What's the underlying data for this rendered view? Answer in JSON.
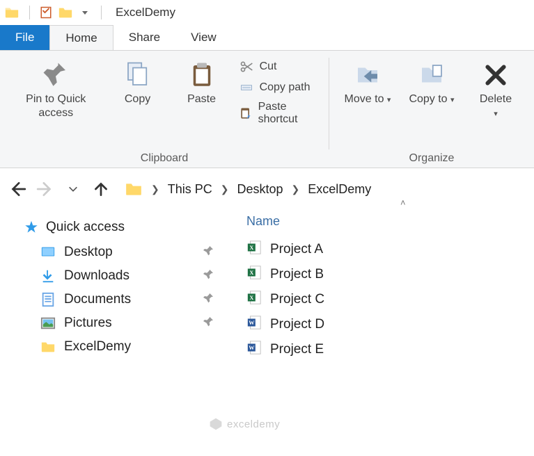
{
  "title": "ExcelDemy",
  "tabs": {
    "file": "File",
    "home": "Home",
    "share": "Share",
    "view": "View"
  },
  "ribbon": {
    "pin": "Pin to Quick access",
    "copy": "Copy",
    "paste": "Paste",
    "cut": "Cut",
    "copypath": "Copy path",
    "pasteshort": "Paste shortcut",
    "clipboard": "Clipboard",
    "moveto": "Move to",
    "copyto": "Copy to",
    "delete": "Delete",
    "organize": "Organize"
  },
  "breadcrumb": {
    "a": "This PC",
    "b": "Desktop",
    "c": "ExcelDemy"
  },
  "sidebar": {
    "head": "Quick access",
    "items": [
      "Desktop",
      "Downloads",
      "Documents",
      "Pictures",
      "ExcelDemy"
    ]
  },
  "columns": {
    "name": "Name"
  },
  "files": [
    {
      "name": "Project A",
      "type": "excel"
    },
    {
      "name": "Project B",
      "type": "excel"
    },
    {
      "name": "Project C",
      "type": "excel"
    },
    {
      "name": "Project D",
      "type": "word"
    },
    {
      "name": "Project E",
      "type": "word"
    }
  ],
  "watermark": "exceldemy"
}
